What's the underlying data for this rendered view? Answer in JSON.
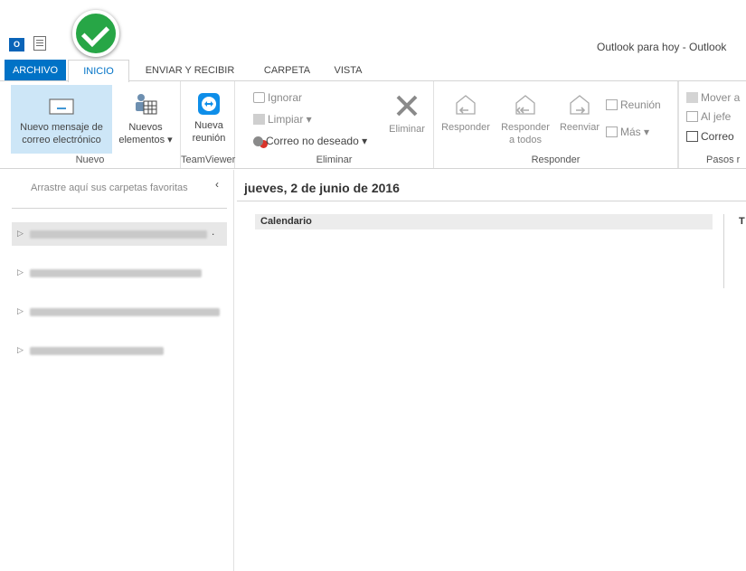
{
  "window": {
    "title": "Outlook para hoy - Outlook",
    "app_icon_text": "0☑"
  },
  "tabs": [
    {
      "label": "ARCHIVO"
    },
    {
      "label": "INICIO"
    },
    {
      "label": "ENVIAR Y RECIBIR"
    },
    {
      "label": "CARPETA"
    },
    {
      "label": "VISTA"
    }
  ],
  "ribbon": {
    "nuevo": {
      "group_label": "Nuevo",
      "nuevo_mensaje_line1": "Nuevo mensaje de",
      "nuevo_mensaje_line2": "correo electrónico",
      "nuevos_line1": "Nuevos",
      "nuevos_line2": "elementos ▾"
    },
    "teamviewer": {
      "group_label": "TeamViewer",
      "line1": "Nueva",
      "line2": "reunión"
    },
    "eliminar": {
      "group_label": "Eliminar",
      "ignorar": "Ignorar",
      "limpiar": "Limpiar ▾",
      "correo_no_deseado": "Correo no deseado ▾",
      "eliminar": "Eliminar"
    },
    "responder": {
      "group_label": "Responder",
      "responder": "Responder",
      "responder_todos_line1": "Responder",
      "responder_todos_line2": "a todos",
      "reenviar": "Reenviar",
      "reunion": "Reunión",
      "mas": "Más ▾"
    },
    "pasos": {
      "group_label": "Pasos r",
      "mover": "Mover a",
      "al_jefe": "Al jefe",
      "correo": "Correo"
    }
  },
  "nav": {
    "favorites_hint": "Arrastre aquí sus carpetas favoritas",
    "collapse_glyph": "‹",
    "account_trailing_dot": "."
  },
  "main": {
    "date": "jueves, 2 de junio de 2016",
    "calendar_label": "Calendario",
    "right_col_initial": "T"
  },
  "colors": {
    "accent": "#0072c6",
    "badge": "#27a646",
    "selected_button": "#cde6f7"
  }
}
